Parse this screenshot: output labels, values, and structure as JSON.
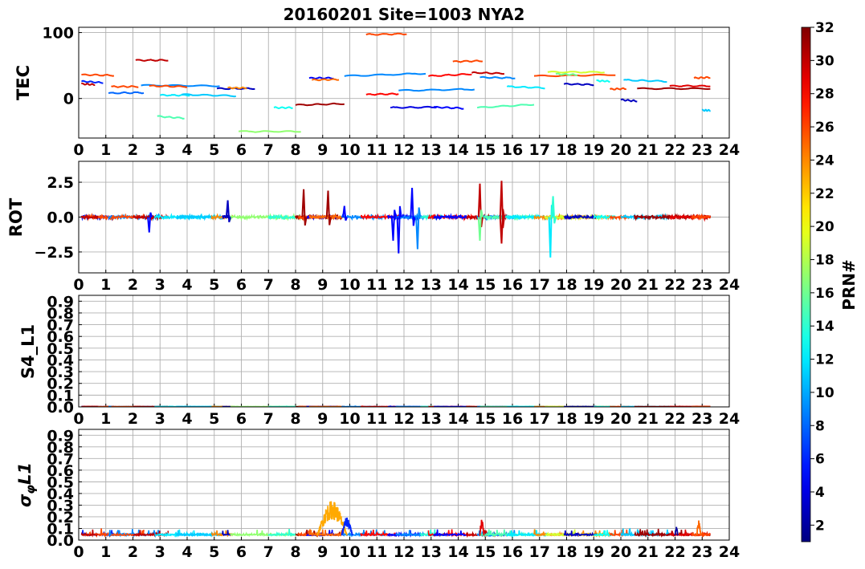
{
  "figure": {
    "title": "20160201 Site=1003 NYA2",
    "colorbar": {
      "label": "PRN#",
      "range": [
        1,
        32
      ],
      "ticks": [
        "2",
        "4",
        "6",
        "8",
        "10",
        "12",
        "14",
        "16",
        "18",
        "20",
        "22",
        "24",
        "26",
        "28",
        "30",
        "32"
      ],
      "colormap": "jet"
    }
  },
  "chart_data": [
    {
      "type": "line",
      "panel": "TEC",
      "ylabel": "TEC",
      "xlim": [
        0,
        24
      ],
      "ylim": [
        -60,
        108
      ],
      "xticks": [
        "0",
        "1",
        "2",
        "3",
        "4",
        "5",
        "6",
        "7",
        "8",
        "9",
        "10",
        "11",
        "12",
        "13",
        "14",
        "15",
        "16",
        "17",
        "18",
        "19",
        "20",
        "21",
        "22",
        "23",
        "24"
      ],
      "yticks": [
        "0",
        "100"
      ],
      "grid": true,
      "segments": [
        {
          "prn": 30,
          "x": [
            0.1,
            0.6
          ],
          "y": [
            22,
            21
          ]
        },
        {
          "prn": 6,
          "x": [
            0.1,
            0.9
          ],
          "y": [
            26,
            24
          ]
        },
        {
          "prn": 26,
          "x": [
            0.1,
            1.3
          ],
          "y": [
            36,
            35
          ]
        },
        {
          "prn": 8,
          "x": [
            1.1,
            2.4
          ],
          "y": [
            8,
            9
          ]
        },
        {
          "prn": 26,
          "x": [
            1.2,
            2.2
          ],
          "y": [
            18,
            18
          ]
        },
        {
          "prn": 30,
          "x": [
            2.1,
            3.3
          ],
          "y": [
            58,
            58
          ]
        },
        {
          "prn": 9,
          "x": [
            2.3,
            5.2
          ],
          "y": [
            20,
            19
          ]
        },
        {
          "prn": 26,
          "x": [
            2.6,
            4.0
          ],
          "y": [
            19,
            18
          ]
        },
        {
          "prn": 12,
          "x": [
            3.0,
            4.1
          ],
          "y": [
            5,
            5
          ]
        },
        {
          "prn": 15,
          "x": [
            2.9,
            3.9
          ],
          "y": [
            -27,
            -30
          ]
        },
        {
          "prn": 11,
          "x": [
            3.8,
            5.8
          ],
          "y": [
            6,
            4
          ]
        },
        {
          "prn": 3,
          "x": [
            5.1,
            6.5
          ],
          "y": [
            15,
            15
          ]
        },
        {
          "prn": 24,
          "x": [
            5.5,
            6.2
          ],
          "y": [
            16,
            16
          ]
        },
        {
          "prn": 17,
          "x": [
            5.9,
            8.2
          ],
          "y": [
            -50,
            -50
          ]
        },
        {
          "prn": 13,
          "x": [
            7.2,
            7.9
          ],
          "y": [
            -14,
            -14
          ]
        },
        {
          "prn": 31,
          "x": [
            8.0,
            9.8
          ],
          "y": [
            -10,
            -8
          ]
        },
        {
          "prn": 5,
          "x": [
            8.5,
            9.4
          ],
          "y": [
            31,
            31
          ]
        },
        {
          "prn": 25,
          "x": [
            8.6,
            9.6
          ],
          "y": [
            28,
            29
          ]
        },
        {
          "prn": 9,
          "x": [
            9.8,
            12.8
          ],
          "y": [
            34,
            38
          ]
        },
        {
          "prn": 28,
          "x": [
            10.6,
            11.8
          ],
          "y": [
            6,
            7
          ]
        },
        {
          "prn": 26,
          "x": [
            10.6,
            12.1
          ],
          "y": [
            97,
            98
          ]
        },
        {
          "prn": 4,
          "x": [
            11.5,
            13.2
          ],
          "y": [
            -14,
            -13
          ]
        },
        {
          "prn": 9,
          "x": [
            11.8,
            14.6
          ],
          "y": [
            12,
            14
          ]
        },
        {
          "prn": 28,
          "x": [
            12.9,
            14.5
          ],
          "y": [
            34,
            37
          ]
        },
        {
          "prn": 5,
          "x": [
            13.1,
            14.2
          ],
          "y": [
            -13,
            -15
          ]
        },
        {
          "prn": 26,
          "x": [
            13.8,
            14.9
          ],
          "y": [
            56,
            57
          ]
        },
        {
          "prn": 30,
          "x": [
            14.5,
            15.7
          ],
          "y": [
            39,
            38
          ]
        },
        {
          "prn": 9,
          "x": [
            14.8,
            16.1
          ],
          "y": [
            32,
            31
          ]
        },
        {
          "prn": 15,
          "x": [
            14.7,
            16.8
          ],
          "y": [
            -14,
            -9
          ]
        },
        {
          "prn": 12,
          "x": [
            15.8,
            17.2
          ],
          "y": [
            18,
            16
          ]
        },
        {
          "prn": 26,
          "x": [
            16.8,
            19.8
          ],
          "y": [
            34,
            36
          ]
        },
        {
          "prn": 19,
          "x": [
            17.3,
            19.4
          ],
          "y": [
            40,
            40
          ]
        },
        {
          "prn": 16,
          "x": [
            17.6,
            18.4
          ],
          "y": [
            37,
            36
          ]
        },
        {
          "prn": 3,
          "x": [
            17.9,
            19.0
          ],
          "y": [
            22,
            21
          ]
        },
        {
          "prn": 13,
          "x": [
            19.1,
            19.6
          ],
          "y": [
            27,
            26
          ]
        },
        {
          "prn": 26,
          "x": [
            19.6,
            20.2
          ],
          "y": [
            14,
            15
          ]
        },
        {
          "prn": 11,
          "x": [
            20.1,
            21.7
          ],
          "y": [
            28,
            26
          ]
        },
        {
          "prn": 3,
          "x": [
            20.0,
            20.6
          ],
          "y": [
            -2,
            -4
          ]
        },
        {
          "prn": 31,
          "x": [
            20.6,
            23.3
          ],
          "y": [
            15,
            15
          ]
        },
        {
          "prn": 29,
          "x": [
            21.8,
            23.3
          ],
          "y": [
            19,
            19
          ]
        },
        {
          "prn": 26,
          "x": [
            22.7,
            23.3
          ],
          "y": [
            31,
            32
          ]
        },
        {
          "prn": 11,
          "x": [
            23.0,
            23.3
          ],
          "y": [
            -18,
            -18
          ]
        }
      ]
    },
    {
      "type": "line",
      "panel": "ROT",
      "ylabel": "ROT",
      "xlim": [
        0,
        24
      ],
      "ylim": [
        -4,
        4
      ],
      "xticks": [
        "0",
        "1",
        "2",
        "3",
        "4",
        "5",
        "6",
        "7",
        "8",
        "9",
        "10",
        "11",
        "12",
        "13",
        "14",
        "15",
        "16",
        "17",
        "18",
        "19",
        "20",
        "21",
        "22",
        "23",
        "24"
      ],
      "yticks": [
        "−2.5",
        "0.0",
        "2.5"
      ],
      "grid": true,
      "spikes": [
        {
          "prn": 3,
          "x": 5.5,
          "y": 1.2
        },
        {
          "prn": 5,
          "x": 2.6,
          "y": -1.1
        },
        {
          "prn": 31,
          "x": 8.3,
          "y": 2.0
        },
        {
          "prn": 31,
          "x": 9.2,
          "y": 1.9
        },
        {
          "prn": 5,
          "x": 9.8,
          "y": 0.8
        },
        {
          "prn": 5,
          "x": 11.8,
          "y": -2.6
        },
        {
          "prn": 5,
          "x": 12.3,
          "y": 2.1
        },
        {
          "prn": 9,
          "x": 12.5,
          "y": -2.3
        },
        {
          "prn": 5,
          "x": 11.6,
          "y": -1.7
        },
        {
          "prn": 30,
          "x": 14.8,
          "y": 2.4
        },
        {
          "prn": 30,
          "x": 15.6,
          "y": 2.6
        },
        {
          "prn": 30,
          "x": 15.6,
          "y": -1.9
        },
        {
          "prn": 12,
          "x": 17.4,
          "y": -2.9
        },
        {
          "prn": 14,
          "x": 17.5,
          "y": 1.5
        },
        {
          "prn": 16,
          "x": 14.8,
          "y": -1.7
        }
      ]
    },
    {
      "type": "line",
      "panel": "S4_L1",
      "ylabel": "S4_L1",
      "xlim": [
        0,
        24
      ],
      "ylim": [
        0,
        0.95
      ],
      "xticks": [
        "0",
        "1",
        "2",
        "3",
        "4",
        "5",
        "6",
        "7",
        "8",
        "9",
        "10",
        "11",
        "12",
        "13",
        "14",
        "15",
        "16",
        "17",
        "18",
        "19",
        "20",
        "21",
        "22",
        "23",
        "24"
      ],
      "yticks": [
        "0.0",
        "0.1",
        "0.2",
        "0.3",
        "0.4",
        "0.5",
        "0.6",
        "0.7",
        "0.8",
        "0.9"
      ],
      "grid": true,
      "baseline": 0.0
    },
    {
      "type": "line",
      "panel": "sigma_phi_L1",
      "ylabel": "σφL1",
      "xlim": [
        0,
        24
      ],
      "ylim": [
        0,
        0.95
      ],
      "xticks": [
        "0",
        "1",
        "2",
        "3",
        "4",
        "5",
        "6",
        "7",
        "8",
        "9",
        "10",
        "11",
        "12",
        "13",
        "14",
        "15",
        "16",
        "17",
        "18",
        "19",
        "20",
        "21",
        "22",
        "23",
        "24"
      ],
      "yticks": [
        "0.0",
        "0.1",
        "0.2",
        "0.3",
        "0.4",
        "0.5",
        "0.6",
        "0.7",
        "0.8",
        "0.9"
      ],
      "grid": true,
      "baseline": 0.04,
      "bursts": [
        {
          "prn": 23,
          "x": [
            8.8,
            9.9
          ],
          "peak": 0.3
        },
        {
          "prn": 6,
          "x": [
            9.7,
            10.1
          ],
          "peak": 0.16
        },
        {
          "prn": 29,
          "x": [
            14.8,
            14.95
          ],
          "peak": 0.16
        },
        {
          "prn": 25,
          "x": [
            22.8,
            22.95
          ],
          "peak": 0.14
        },
        {
          "prn": 2,
          "x": [
            22.0,
            22.1
          ],
          "peak": 0.08
        }
      ]
    }
  ]
}
